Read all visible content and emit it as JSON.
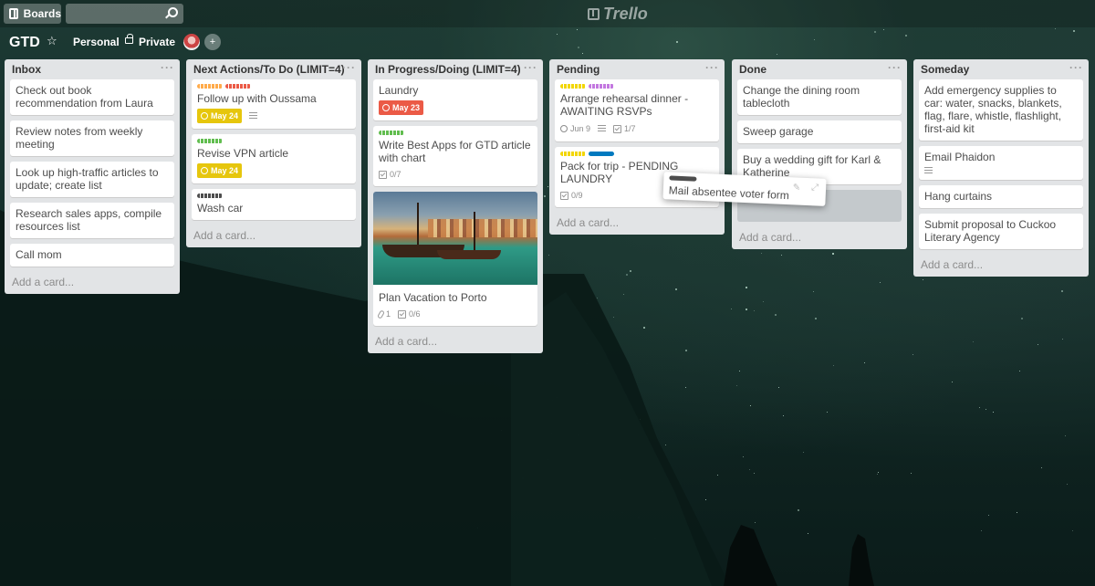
{
  "header": {
    "boards_label": "Boards",
    "search_value": "",
    "logo_text": "Trello"
  },
  "board": {
    "title": "GTD",
    "team": "Personal",
    "visibility": "Private"
  },
  "lists": [
    {
      "title": "Inbox",
      "menu": "···",
      "cards": [
        {
          "text": "Check out book recommendation from Laura"
        },
        {
          "text": "Review notes from weekly meeting"
        },
        {
          "text": "Look up high-traffic articles to update; create list"
        },
        {
          "text": "Research sales apps, compile resources list"
        },
        {
          "text": "Call mom"
        }
      ],
      "add_card": "Add a card..."
    },
    {
      "title": "Next Actions/To Do (LIMIT=4)",
      "menu": "···",
      "cards": [
        {
          "text": "Follow up with Oussama",
          "labels": [
            "orange",
            "red"
          ],
          "due": "May 24",
          "due_color": "yellow",
          "has_description": true
        },
        {
          "text": "Revise VPN article",
          "labels": [
            "green"
          ],
          "due": "May 24",
          "due_color": "yellow"
        },
        {
          "text": "Wash car",
          "labels": [
            "black"
          ]
        }
      ],
      "add_card": "Add a card..."
    },
    {
      "title": "In Progress/Doing (LIMIT=4)",
      "menu": "···",
      "cards": [
        {
          "text": "Laundry",
          "due": "May 23",
          "due_color": "red"
        },
        {
          "text": "Write Best Apps for GTD article with chart",
          "labels": [
            "green"
          ],
          "checklist": "0/7"
        },
        {
          "text": "Plan Vacation to Porto",
          "cover": "porto-boats-photo",
          "attachments": "1",
          "checklist": "0/6"
        }
      ],
      "add_card": "Add a card..."
    },
    {
      "title": "Pending",
      "menu": "···",
      "cards": [
        {
          "text": "Arrange rehearsal dinner - AWAITING RSVPs",
          "labels": [
            "yellow",
            "purple"
          ],
          "due": "Jun 9",
          "due_color": "plain",
          "has_description": true,
          "checklist": "1/7"
        },
        {
          "text": "Pack for trip - PENDING LAUNDRY",
          "labels": [
            "yellow",
            "blue"
          ],
          "checklist": "0/9"
        }
      ],
      "add_card": "Add a card..."
    },
    {
      "title": "Done",
      "menu": "···",
      "cards": [
        {
          "text": "Change the dining room tablecloth"
        },
        {
          "text": "Sweep garage"
        },
        {
          "text": "Buy a wedding gift for Karl & Katherine"
        }
      ],
      "add_card": "Add a card..."
    },
    {
      "title": "Someday",
      "menu": "···",
      "cards": [
        {
          "text": "Add emergency supplies to car: water, snacks, blankets, flag, flare, whistle, flashlight, first-aid kit"
        },
        {
          "text": "Email Phaidon",
          "has_description": true
        },
        {
          "text": "Hang curtains"
        },
        {
          "text": "Submit proposal to Cuckoo Literary Agency"
        }
      ],
      "add_card": "Add a card..."
    }
  ],
  "dragging_card": {
    "text": "Mail absentee voter form",
    "labels": [
      "black"
    ]
  },
  "colors": {
    "list_bg": "#e2e4e6",
    "due_yellow": "#e6c60d",
    "due_red": "#eb5a46",
    "label_blue": "#0079bf"
  }
}
